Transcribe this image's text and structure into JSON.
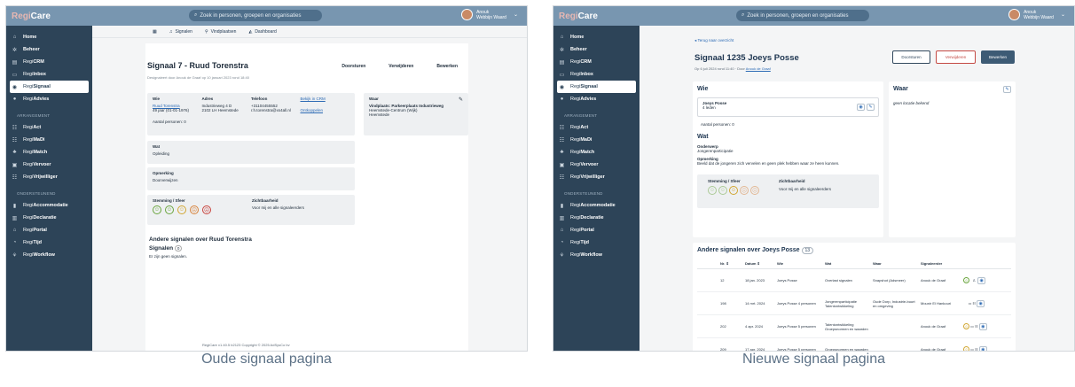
{
  "common": {
    "search": "Zoek in personen, groepen en organisaties",
    "user_name": "Anouk",
    "user_place": "Webbijn Waard",
    "logo_regi": "Regi",
    "logo_care": "Care"
  },
  "sidebar": {
    "items": [
      {
        "icon": "home-icon",
        "glyph": "⌂",
        "label": "Home"
      },
      {
        "icon": "gear-icon",
        "glyph": "✲",
        "label": "Beheer",
        "bold": true
      },
      {
        "icon": "crm-icon",
        "glyph": "▤",
        "label": "CRM",
        "pre": "Regi"
      },
      {
        "icon": "inbox-icon",
        "glyph": "▭",
        "label": "Inbox",
        "pre": "Regi"
      },
      {
        "icon": "eye-icon",
        "glyph": "◉",
        "label": "Signaal",
        "pre": "Regi"
      },
      {
        "icon": "info-icon",
        "glyph": "●",
        "label": "Advies",
        "pre": "Regi"
      }
    ],
    "section1": "ARRANGEMENT",
    "items2": [
      {
        "icon": "act-icon",
        "glyph": "☷",
        "label": "Act"
      },
      {
        "icon": "madi-icon",
        "glyph": "☷",
        "label": "MaDi"
      },
      {
        "icon": "match-icon",
        "glyph": "♣",
        "label": "Match"
      },
      {
        "icon": "vervoer-icon",
        "glyph": "▣",
        "label": "Vervoer"
      },
      {
        "icon": "vrijwilliger-icon",
        "glyph": "☷",
        "label": "Vrijwilliger"
      }
    ],
    "section2": "ONDERSTEUNEND",
    "items3": [
      {
        "icon": "accommodatie-icon",
        "glyph": "▮",
        "label": "Accommodatie"
      },
      {
        "icon": "declaratie-icon",
        "glyph": "▥",
        "label": "Declaratie"
      },
      {
        "icon": "portal-icon",
        "glyph": "⌂",
        "label": "Portal"
      },
      {
        "icon": "tijd-icon",
        "glyph": "◔",
        "label": "Tijd"
      },
      {
        "icon": "workflow-icon",
        "glyph": "⚘",
        "label": "Workflow"
      }
    ]
  },
  "old": {
    "tabs": [
      "Signalen",
      "Vindplaatsen",
      "Dashboard"
    ],
    "title": "Signaal 7 - Ruud Torenstra",
    "actions": [
      "Doorsturen",
      "Verwijderen",
      "Bewerken"
    ],
    "subtitle": "Designaleert door Anouk de Graaf op 10 januari 2023 rond 18:40",
    "wie": {
      "h_wie": "Wie",
      "h_adres": "Adres",
      "h_tel": "Telefoon",
      "link_crm": "Bekijk in CRM",
      "name": "Ruud Torenstra",
      "age": "49 jaar (01-01-1976)",
      "adres1": "Industrieweg 4 D",
      "adres2": "2102 LH Heemstede",
      "tel": "+31104455552",
      "email": "r.h.torenstra@xs4all.nl",
      "ontkoppelen": "Ontkoppelen",
      "aantal": "Aantal personen: 0"
    },
    "waar": {
      "h": "Waar",
      "l1": "Vindplaats: Parkeerplaats Industrieweg",
      "l2": "Heemstede-Centrum (Wijk)",
      "l3": "Heemstede"
    },
    "wat": {
      "h": "Wat",
      "v": "Opleiding"
    },
    "opm": {
      "h": "Opmerking",
      "v": "Doorverwijzen"
    },
    "stem": {
      "h": "Stemming / Sfeer",
      "zh": "Zichtbaarheid",
      "zv": "Voor mij en alle signaleerders"
    },
    "andere_h": "Andere signalen over Ruud Torenstra",
    "signalen": "Signalen",
    "count": "0",
    "geen": "Er zijn geen signalen.",
    "footer": "RegiCare v1.40.5 b2123    Copyright © 2025 AdSysCo bv"
  },
  "new": {
    "back": "Terug naar overzicht",
    "title": "Signaal 1235 Joeys Posse",
    "subtitle": "Op 6 juli 2024 rond 11:40  ·  Door",
    "subtitle_link": "Anouk de Graaf",
    "buttons": [
      "Doorsturen",
      "Verwijderen",
      "Bewerken"
    ],
    "wie": {
      "h": "Wie",
      "name": "Joeys Posse",
      "leden": "4 leden",
      "aantal": "Aantal personen: 0",
      "wat": "Wat",
      "ond_h": "Onderwerp",
      "ond": "Jongerenparticipatie",
      "opm_h": "Opmerking",
      "opm": "Beeld dat de jongeren zich vervelen en geen plek hebben waar ze heen kunnen.",
      "stem": "Stemming / Sfeer",
      "zh": "Zichtbaarheid",
      "zv": "Voor mij en alle signaleerders"
    },
    "waar": {
      "h": "Waar",
      "v": "geen locatie bekend"
    },
    "andere": {
      "h": "Andere signalen over Joeys Posse",
      "count": "13",
      "cols": [
        "Nr. ⇕",
        "Datum ⇕",
        "Wie",
        "Wat",
        "Waar",
        "Signaleerder"
      ],
      "rows": [
        [
          "12",
          "18 jan. 2023",
          "Joeys Posse",
          "Overlast signalen",
          "Snapshot (Adsmeer)",
          "Anouk de Graaf"
        ],
        [
          "198",
          "14 mrt. 2024",
          "Joeys Posse 4 personen",
          "Jongerenparticipatie Talentontwikkeling",
          "Oude Dorp, Industrie-buurt en omgeving",
          "Mounir El Hankouri"
        ],
        [
          "202",
          "4 apr. 2024",
          "Joeys Posse 5 personen",
          "Talentontwikkeling Groepsnormen en waarden",
          "",
          "Anouk de Graaf"
        ],
        [
          "209",
          "17 apr. 2024",
          "Joeys Posse 5 personen",
          "Groepsnormen en waarden",
          "",
          "Anouk de Graaf"
        ]
      ]
    }
  },
  "captions": {
    "old": "Oude signaal pagina",
    "new": "Nieuwe signaal pagina"
  }
}
